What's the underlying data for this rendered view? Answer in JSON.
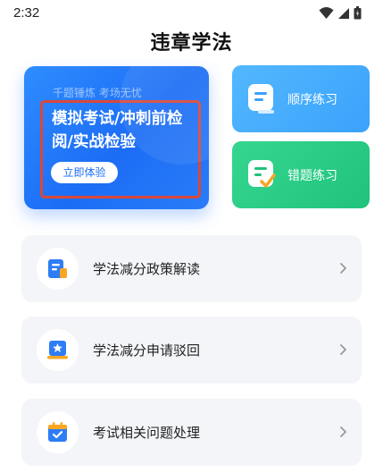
{
  "status_bar": {
    "time": "2:32"
  },
  "header": {
    "title": "违章学法"
  },
  "exam_card": {
    "tagline": "千题锤炼 考场无忧",
    "headline": "模拟考试/冲刺前检阅/实战检验",
    "button_label": "立即体验"
  },
  "practice": {
    "order_label": "顺序练习",
    "wrong_label": "错题练习"
  },
  "menu": {
    "items": [
      {
        "label": "学法减分政策解读",
        "icon": "document-icon"
      },
      {
        "label": "学法减分申请驳回",
        "icon": "badge-star-icon"
      },
      {
        "label": "考试相关问题处理",
        "icon": "calendar-check-icon"
      }
    ]
  },
  "colors": {
    "accent_blue": "#1c6df5",
    "order_card": "#3aa2fb",
    "wrong_card": "#20c27c",
    "highlight_border": "#d9483b",
    "menu_bg": "#f4f5f8"
  }
}
